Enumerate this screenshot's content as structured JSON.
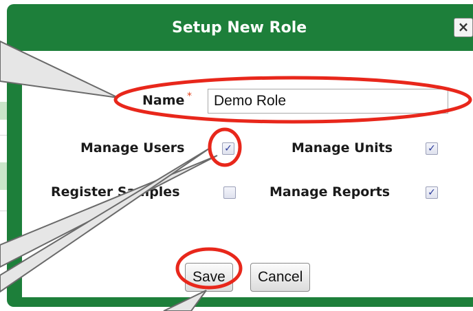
{
  "dialog": {
    "title": "Setup New Role",
    "close_symbol": "×"
  },
  "form": {
    "name_label": "Name",
    "required_mark": "*",
    "name_value": "Demo Role",
    "permissions": [
      {
        "label": "Manage Users",
        "checked": true
      },
      {
        "label": "Manage Units",
        "checked": true
      },
      {
        "label": "Register Samples",
        "checked": false
      },
      {
        "label": "Manage Reports",
        "checked": true
      }
    ],
    "check_mark": "✓"
  },
  "buttons": {
    "save_label": "Save",
    "cancel_label": "Cancel"
  },
  "colors": {
    "dialog_green": "#1d7f3a",
    "annotation_red": "#e8271b",
    "callout_gray": "#e6e6e6"
  },
  "icons": [
    "close-icon",
    "required-asterisk-icon",
    "checkbox-check-icon"
  ]
}
